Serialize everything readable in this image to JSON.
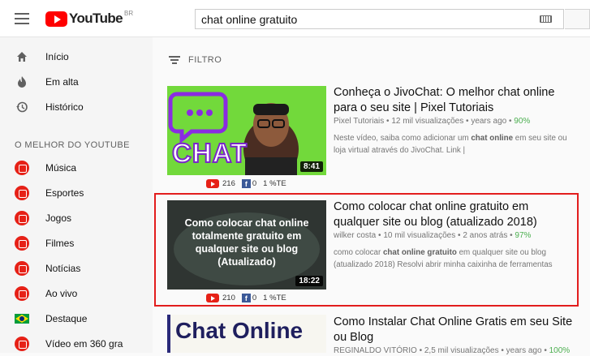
{
  "header": {
    "logo_text": "YouTube",
    "logo_region": "BR",
    "search_value": "chat online gratuito"
  },
  "sidebar": {
    "items": [
      {
        "label": "Início",
        "icon": "home-icon"
      },
      {
        "label": "Em alta",
        "icon": "trending-icon"
      },
      {
        "label": "Histórico",
        "icon": "history-icon"
      }
    ],
    "section_title": "O MELHOR DO YOUTUBE",
    "best_of": [
      {
        "label": "Música",
        "icon": "music-icon"
      },
      {
        "label": "Esportes",
        "icon": "sports-icon"
      },
      {
        "label": "Jogos",
        "icon": "gaming-icon"
      },
      {
        "label": "Filmes",
        "icon": "movies-icon"
      },
      {
        "label": "Notícias",
        "icon": "news-icon"
      },
      {
        "label": "Ao vivo",
        "icon": "live-icon"
      },
      {
        "label": "Destaque",
        "icon": "spotlight-icon"
      },
      {
        "label": "Vídeo em 360 gra",
        "icon": "video-360-icon"
      }
    ]
  },
  "filter": {
    "label": "FILTRO"
  },
  "results": [
    {
      "title": "Conheça o JivoChat: O melhor chat online para o seu site | Pixel Tutoriais",
      "channel": "Pixel Tutoriais",
      "views": "12 mil visualizações",
      "age": "years ago",
      "percent": "90%",
      "desc_pre": "Neste vídeo, saiba como adicionar um ",
      "desc_bold": "chat online",
      "desc_post": " em seu site ou loja virtual através do JivoChat. Link |",
      "duration": "8:41",
      "thumb_text": "CHAT",
      "likes": "216",
      "fb": "0",
      "te": "1 %TE"
    },
    {
      "title": "Como colocar chat online gratuito em qualquer site ou blog (atualizado 2018)",
      "channel": "wilker costa",
      "views": "10 mil visualizações",
      "age": "2 anos atrás",
      "percent": "97%",
      "desc_pre": "como colocar ",
      "desc_bold": "chat online gratuito",
      "desc_post": " em qualquer site ou blog (atualizado 2018) Resolvi abrir minha caixinha de ferramentas",
      "duration": "18:22",
      "thumb_text": "Como colocar chat online totalmente gratuito em qualquer site ou blog (Atualizado)",
      "likes": "210",
      "fb": "0",
      "te": "1 %TE"
    },
    {
      "title": "Como Instalar Chat Online Gratis em seu Site ou Blog",
      "channel": "REGINALDO VITÓRIO",
      "views": "2,5 mil visualizações",
      "age": "years ago",
      "percent": "100%",
      "thumb_text": "Chat Online"
    }
  ],
  "colors": {
    "brand_red": "#ff0000",
    "highlight": "#e21d1d",
    "percent_green": "#4caf50"
  }
}
